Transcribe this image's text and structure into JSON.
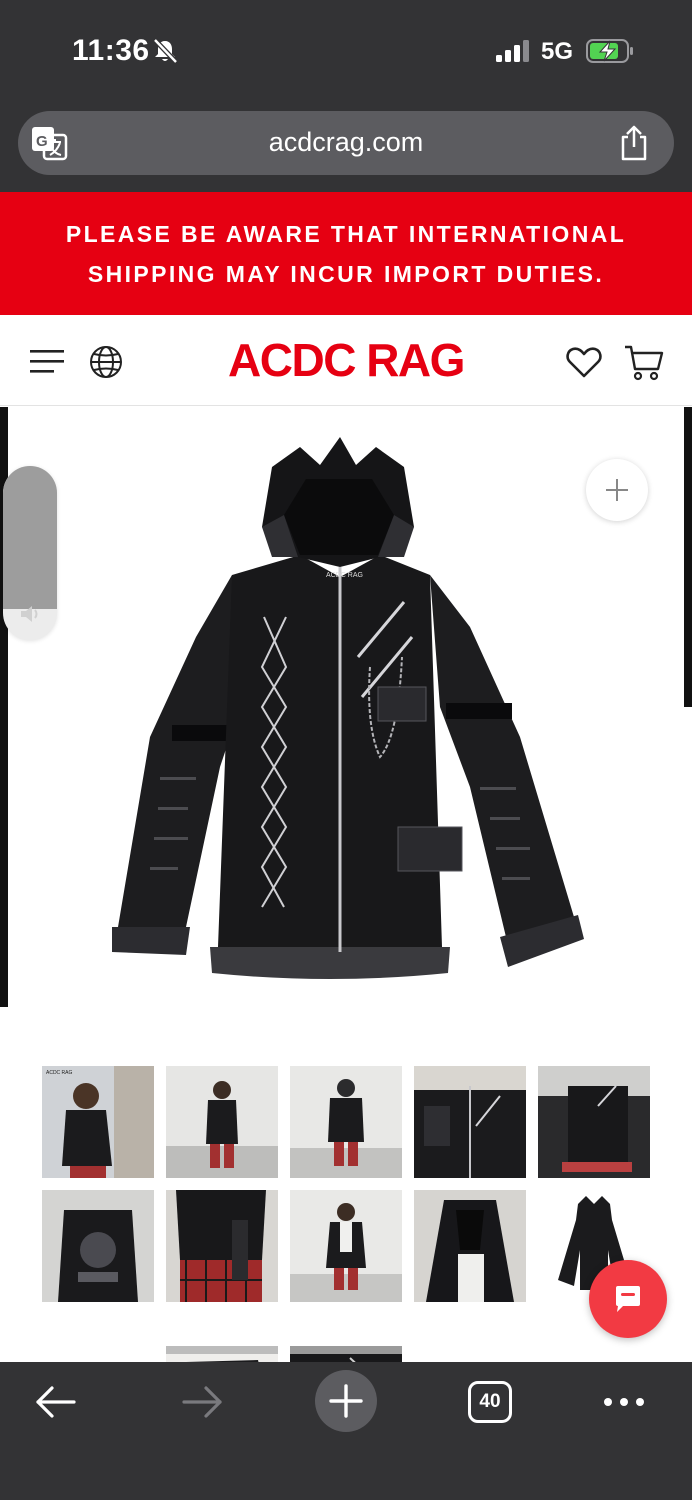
{
  "status_bar": {
    "time": "11:36",
    "network": "5G",
    "icons": [
      "bell-slash-icon",
      "signal-icon",
      "battery-charging-icon"
    ]
  },
  "browser": {
    "url": "acdcrag.com",
    "icons": [
      "translate-icon",
      "share-icon"
    ]
  },
  "notice": {
    "text": "PLEASE BE AWARE THAT INTERNATIONAL SHIPPING MAY INCUR IMPORT DUTIES.",
    "background": "#e60012"
  },
  "header": {
    "logo": "ACDC RAG",
    "brand_color": "#e60012",
    "icons": [
      "menu-icon",
      "globe-icon",
      "heart-icon",
      "cart-icon"
    ]
  },
  "product": {
    "tag_text": "ACDC RAG",
    "zoom_icon": "plus-icon",
    "thumbnail_count_visible": 13
  },
  "volume": {
    "level": 0.82,
    "icon": "speaker-icon"
  },
  "chat": {
    "icon": "chat-bubble-icon",
    "color": "#f23a43"
  },
  "toolbar": {
    "tab_count": "40",
    "icons": [
      "back-arrow-icon",
      "forward-arrow-icon",
      "plus-icon",
      "tabs-icon",
      "more-icon"
    ]
  }
}
